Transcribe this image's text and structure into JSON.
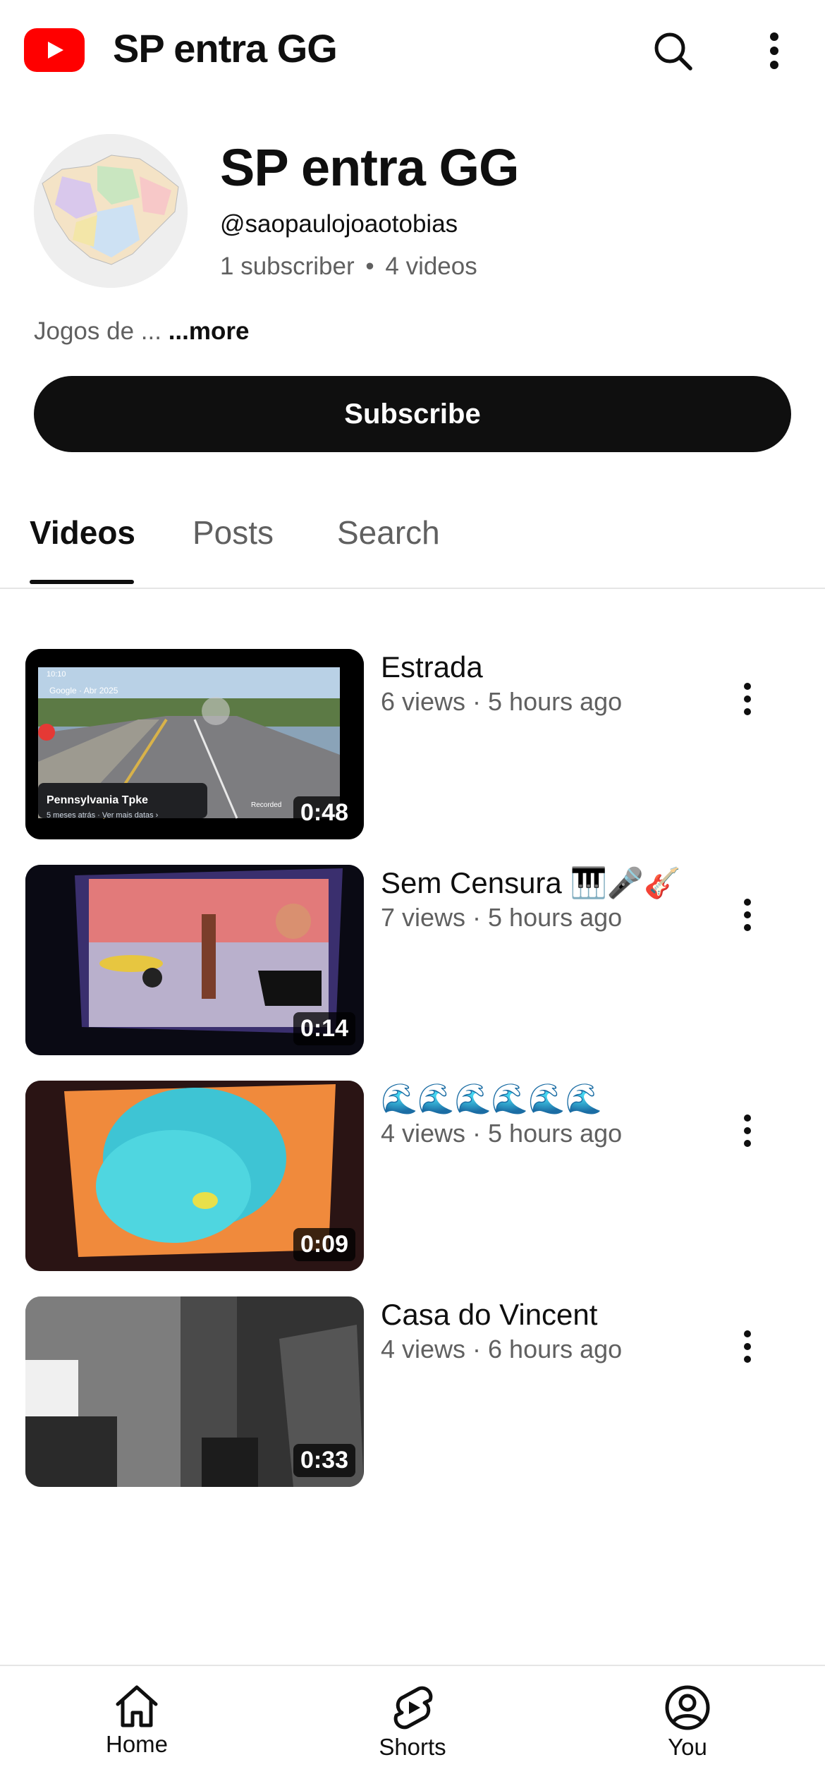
{
  "topbar": {
    "title": "SP entra GG",
    "logo_icon": "youtube-logo-icon",
    "search_icon": "search-icon",
    "more_icon": "more-vertical-icon"
  },
  "channel": {
    "name": "SP entra GG",
    "handle": "@saopaulojoaotobias",
    "subscribers": "1 subscriber",
    "separator": "•",
    "videos_count": "4 videos",
    "description": "Jogos de ...",
    "more_label": "...more",
    "subscribe_label": "Subscribe"
  },
  "tabs": [
    {
      "label": "Videos",
      "active": true
    },
    {
      "label": "Posts",
      "active": false
    },
    {
      "label": "Search",
      "active": false
    }
  ],
  "videos": [
    {
      "title": "Estrada",
      "meta": "6 views · 5 hours ago",
      "duration": "0:48",
      "overlay": {
        "clock": "10:10",
        "brand": "Google",
        "date": "Abr 2025",
        "place": "Pennsylvania Tpke",
        "sub": "5 meses atrás · Ver mais datas ›",
        "recorded": "Recorded"
      }
    },
    {
      "title": "Sem Censura 🎹🎤🎸",
      "meta": "7 views · 5 hours ago",
      "duration": "0:14"
    },
    {
      "title": "🌊🌊🌊🌊🌊🌊",
      "meta": "4 views · 5 hours ago",
      "duration": "0:09"
    },
    {
      "title": "Casa do Vincent",
      "meta": "4 views · 6 hours ago",
      "duration": "0:33"
    }
  ],
  "bottom_nav": [
    {
      "label": "Home",
      "icon": "home-icon"
    },
    {
      "label": "Shorts",
      "icon": "shorts-icon"
    },
    {
      "label": "You",
      "icon": "account-circle-icon"
    }
  ],
  "colors": {
    "brand_red": "#ff0000",
    "text": "#0f0f0f",
    "secondary_text": "#606060",
    "button_bg": "#0f0f0f"
  }
}
